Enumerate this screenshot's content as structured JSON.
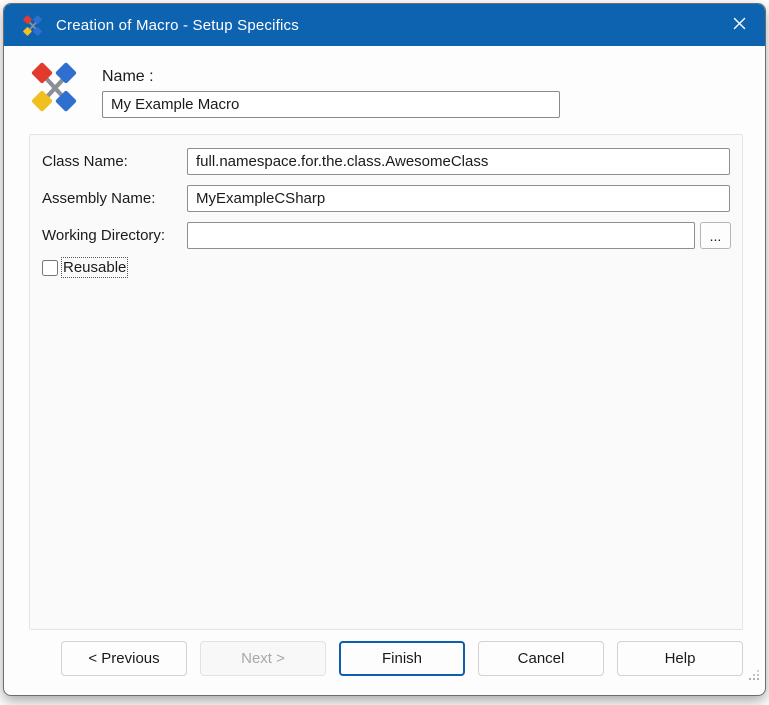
{
  "window": {
    "title": "Creation of Macro - Setup Specifics"
  },
  "header": {
    "name_label": "Name :",
    "name_value": "My Example Macro"
  },
  "form": {
    "class_name": {
      "label": "Class Name:",
      "value": "full.namespace.for.the.class.AwesomeClass"
    },
    "assembly_name": {
      "label": "Assembly Name:",
      "value": "MyExampleCSharp"
    },
    "working_directory": {
      "label": "Working Directory:",
      "value": ""
    },
    "browse_label": "...",
    "reusable": {
      "label": "Reusable",
      "checked": false
    }
  },
  "buttons": {
    "previous": "< Previous",
    "next": "Next >",
    "finish": "Finish",
    "cancel": "Cancel",
    "help": "Help"
  },
  "icons": {
    "titlebar": "macro-icon",
    "close": "close-icon"
  },
  "colors": {
    "titlebar": "#0d63b0",
    "accent": "#0b5fae"
  }
}
